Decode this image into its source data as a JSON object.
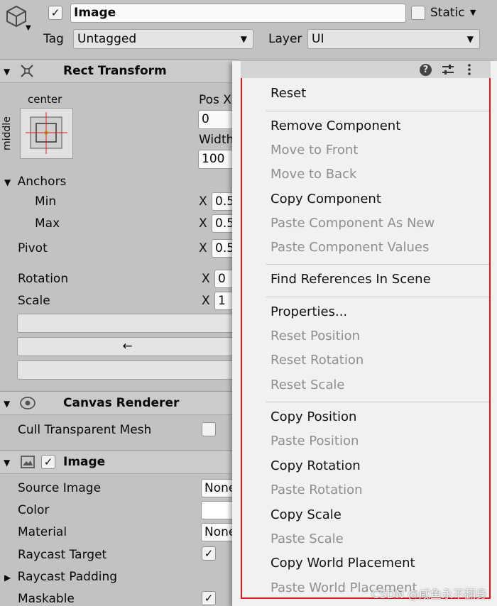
{
  "header": {
    "object_name": "Image",
    "active_checked": "✓",
    "static_label": "Static",
    "tag_label": "Tag",
    "tag_value": "Untagged",
    "layer_label": "Layer",
    "layer_value": "UI"
  },
  "rect_transform": {
    "title": "Rect Transform",
    "anchor_preset_h": "center",
    "anchor_preset_v": "middle",
    "pos_x_label": "Pos X",
    "pos_x_value": "0",
    "width_label": "Width",
    "width_value": "100",
    "anchors_label": "Anchors",
    "min_label": "Min",
    "max_label": "Max",
    "pivot_label": "Pivot",
    "rotation_label": "Rotation",
    "scale_label": "Scale",
    "x_label": "X",
    "min_x_value": "0.5",
    "max_x_value": "0.5",
    "pivot_x_value": "0.5",
    "rotation_x_value": "0",
    "scale_x_value": "1",
    "arrow_button": "←"
  },
  "canvas_renderer": {
    "title": "Canvas Renderer",
    "cull_label": "Cull Transparent Mesh"
  },
  "image_component": {
    "title": "Image",
    "enabled_checked": "✓",
    "source_image_label": "Source Image",
    "source_image_value": "None",
    "color_label": "Color",
    "material_label": "Material",
    "material_value": "None",
    "raycast_target_label": "Raycast Target",
    "raycast_target_checked": "✓",
    "raycast_padding_label": "Raycast Padding",
    "maskable_label": "Maskable",
    "maskable_checked": "✓"
  },
  "context_menu": {
    "items": [
      {
        "label": "Reset",
        "enabled": true
      },
      {
        "label": "Remove Component",
        "enabled": true
      },
      {
        "label": "Move to Front",
        "enabled": false
      },
      {
        "label": "Move to Back",
        "enabled": false
      },
      {
        "label": "Copy Component",
        "enabled": true
      },
      {
        "label": "Paste Component As New",
        "enabled": false
      },
      {
        "label": "Paste Component Values",
        "enabled": false
      },
      {
        "label": "Find References In Scene",
        "enabled": true
      },
      {
        "label": "Properties...",
        "enabled": true
      },
      {
        "label": "Reset Position",
        "enabled": false
      },
      {
        "label": "Reset Rotation",
        "enabled": false
      },
      {
        "label": "Reset Scale",
        "enabled": false
      },
      {
        "label": "Copy Position",
        "enabled": true
      },
      {
        "label": "Paste Position",
        "enabled": false
      },
      {
        "label": "Copy Rotation",
        "enabled": true
      },
      {
        "label": "Paste Rotation",
        "enabled": false
      },
      {
        "label": "Copy Scale",
        "enabled": true
      },
      {
        "label": "Paste Scale",
        "enabled": false
      },
      {
        "label": "Copy World Placement",
        "enabled": true
      },
      {
        "label": "Paste World Placement",
        "enabled": false
      }
    ]
  },
  "watermark": "CSDN @咸鱼永不翻身",
  "colors": {
    "panel_bg": "#c2c2c2",
    "menu_bg": "#f1f1f1",
    "highlight_border": "#e1121a",
    "disabled_text": "#8e8e8e"
  }
}
